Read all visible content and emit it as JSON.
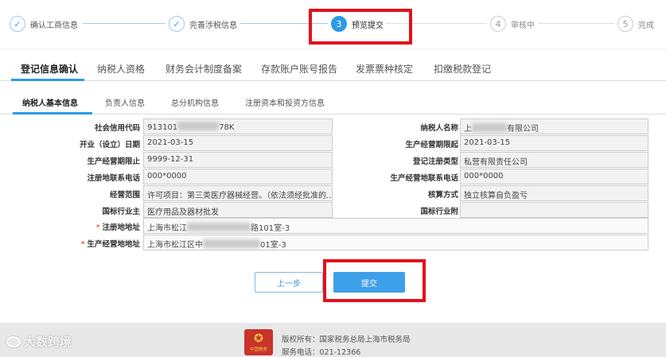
{
  "steps": [
    {
      "label": "确认工商信息",
      "status": "done"
    },
    {
      "label": "完善涉税信息",
      "status": "done"
    },
    {
      "number": "3",
      "label": "预览提交",
      "status": "active"
    },
    {
      "number": "4",
      "label": "审核中",
      "status": "todo"
    },
    {
      "number": "5",
      "label": "完成",
      "status": "todo"
    }
  ],
  "main_tabs": [
    "登记信息确认",
    "纳税人资格",
    "财务会计制度备案",
    "存款账户账号报告",
    "发票票种核定",
    "扣缴税款登记"
  ],
  "sub_tabs": [
    "纳税人基本信息",
    "负责人信息",
    "总分机构信息",
    "注册资本和投资方信息"
  ],
  "form": {
    "credit_code": {
      "label": "社会信用代码",
      "value_prefix": "913101",
      "value_suffix": "78K"
    },
    "taxpayer_name": {
      "label": "纳税人名称",
      "value_prefix": "上",
      "value_suffix": "有限公司"
    },
    "open_date": {
      "label": "开业（设立）日期",
      "value": "2021-03-15"
    },
    "op_start": {
      "label": "生产经营期限起",
      "value": "2021-03-15"
    },
    "op_end": {
      "label": "生产经营期限止",
      "value": "9999-12-31"
    },
    "reg_type": {
      "label": "登记注册类型",
      "value": "私营有限责任公司"
    },
    "reg_phone": {
      "label": "注册地联系电话",
      "value": "000*0000"
    },
    "op_phone": {
      "label": "生产经营地联系电话",
      "value": "000*0000"
    },
    "scope": {
      "label": "经营范围",
      "value": "许可项目：第三类医疗器械经营。（依法须经批准的..."
    },
    "accounting": {
      "label": "核算方式",
      "value": "独立核算自负盈亏"
    },
    "industry_main": {
      "label": "国标行业主",
      "value": "医疗用品及器材批发"
    },
    "industry_sub": {
      "label": "国标行业附",
      "value": ""
    },
    "reg_address": {
      "label": "注册地地址",
      "value_prefix": "上海市松江",
      "value_suffix": "路101室-3"
    },
    "op_address": {
      "label": "生产经营地地址",
      "value_prefix": "上海市松江区中",
      "value_suffix": "01室-3"
    }
  },
  "buttons": {
    "prev": "上一步",
    "submit": "提交"
  },
  "footer": {
    "copyright": "版权所有：国家税务总局上海市税务局",
    "phone": "服务电话：021-12366",
    "emblem_text": "中国税务"
  },
  "watermark": "大数跨境",
  "colors": {
    "accent": "#2e9be6",
    "highlight": "#e3101c"
  }
}
